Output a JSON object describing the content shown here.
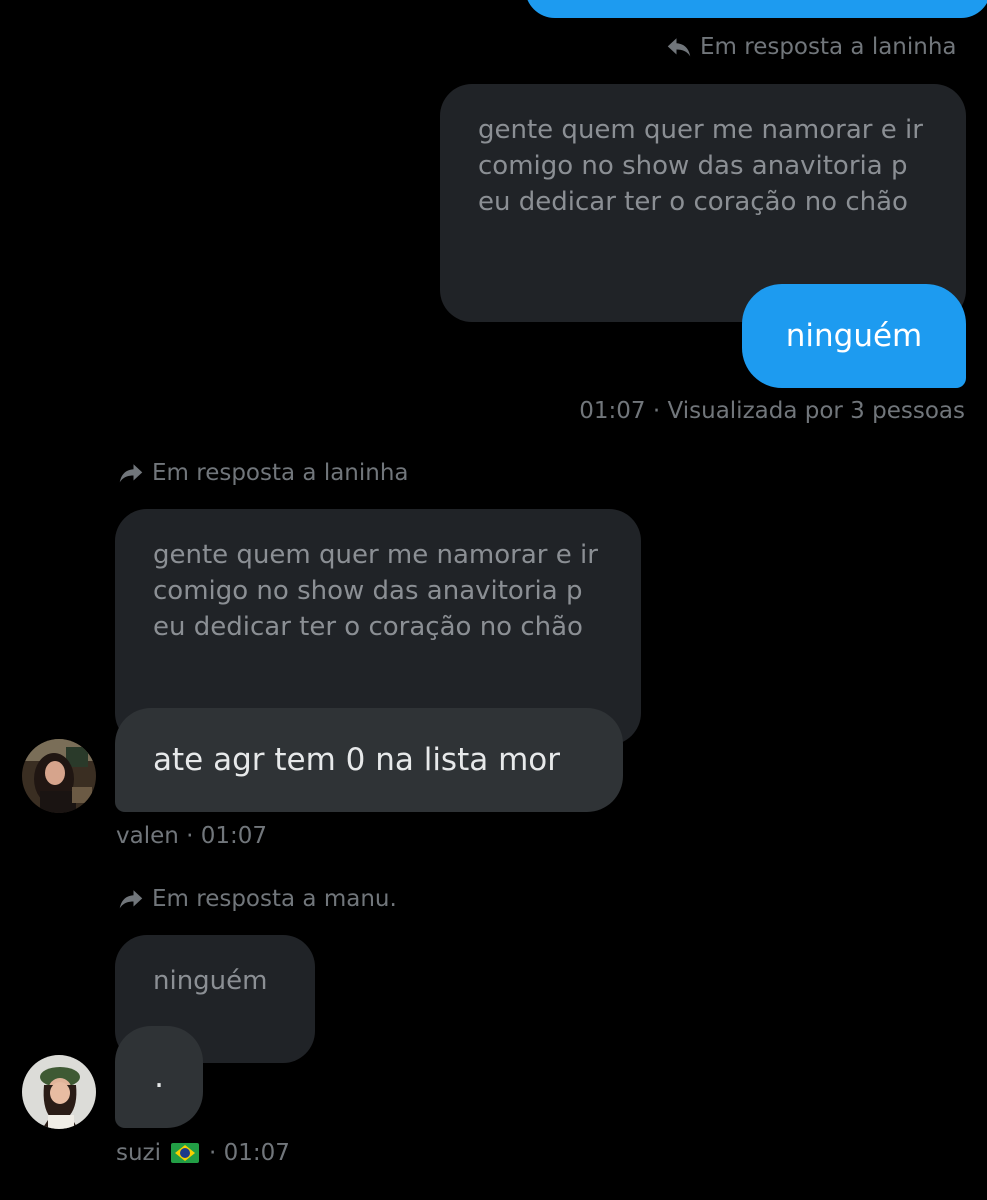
{
  "conversation": {
    "top_reply": {
      "reply_label": "Em resposta a laninha",
      "quoted_text": "gente quem quer me namorar e ir comigo no show das anavitoria p eu dedicar ter o coração no chão",
      "message": "ninguém",
      "time": "01:07",
      "seen": "· Visualizada por 3 pessoas"
    },
    "valen": {
      "reply_label": "Em resposta a laninha",
      "quoted_text": "gente quem quer me namorar e ir comigo no show das anavitoria p eu dedicar ter o coração no chão",
      "message": "ate agr tem 0 na lista mor",
      "author": "valen",
      "time": "· 01:07"
    },
    "suzi": {
      "reply_label": "Em resposta a manu.",
      "quoted_text": "ninguém",
      "message": ".",
      "author": "suzi",
      "time": "· 01:07"
    }
  },
  "colors": {
    "background": "#000000",
    "accent_blue": "#1d9bf0",
    "bubble_dark": "#2f3336",
    "quote_bubble": "#202327",
    "muted_text": "#71767b"
  },
  "icons": {
    "reply_outgoing": "reply-arrow-icon",
    "reply_incoming": "forward-arrow-icon",
    "flag": "brazil-flag-icon"
  }
}
